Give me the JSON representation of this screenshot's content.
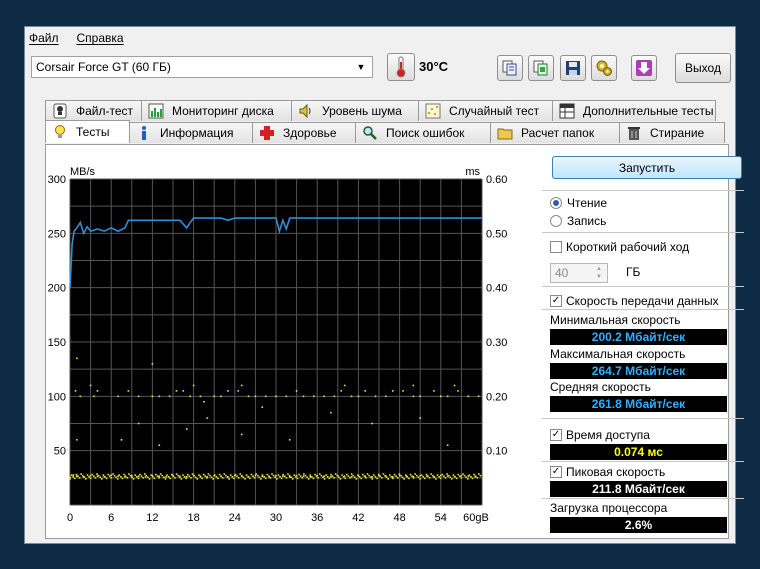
{
  "menu": [
    {
      "label": "Файл"
    },
    {
      "label": "Справка"
    }
  ],
  "toolbar": {
    "drive": "Corsair Force GT (60 ГБ)",
    "temperature": "30°C",
    "exit_label": "Выход"
  },
  "tabs_top": [
    {
      "label": "Файл-тест",
      "icon": "info-pin-icon"
    },
    {
      "label": "Мониторинг диска",
      "icon": "bar-chart-icon"
    },
    {
      "label": "Уровень шума",
      "icon": "speaker-icon"
    },
    {
      "label": "Случайный тест",
      "icon": "scatter-icon"
    },
    {
      "label": "Дополнительные тесты",
      "icon": "table-icon"
    }
  ],
  "tabs_bottom": [
    {
      "label": "Тесты",
      "icon": "lightbulb-icon",
      "active": true
    },
    {
      "label": "Информация",
      "icon": "info-icon"
    },
    {
      "label": "Здоровье",
      "icon": "red-cross-icon"
    },
    {
      "label": "Поиск ошибок",
      "icon": "magnifier-icon"
    },
    {
      "label": "Расчет папок",
      "icon": "folder-icon"
    },
    {
      "label": "Стирание",
      "icon": "trash-icon"
    }
  ],
  "chart_data": {
    "type": "line",
    "y_left_label": "MB/s",
    "y_right_label": "ms",
    "x_ticks": [
      "0",
      "6",
      "12",
      "18",
      "24",
      "30",
      "36",
      "42",
      "48",
      "54",
      "60gB"
    ],
    "y_left_ticks": [
      "300",
      "250",
      "200",
      "150",
      "100",
      "50"
    ],
    "y_right_ticks": [
      "0.60",
      "0.50",
      "0.40",
      "0.30",
      "0.20",
      "0.10"
    ],
    "ylim_left": [
      0,
      300
    ],
    "ylim_right": [
      0,
      0.6
    ],
    "xlim": [
      0,
      60
    ],
    "grid": true,
    "series": [
      {
        "type": "line",
        "color": "#2f8fd6",
        "points": [
          [
            0,
            200
          ],
          [
            0.3,
            240
          ],
          [
            0.6,
            252
          ],
          [
            1,
            255
          ],
          [
            1.5,
            260
          ],
          [
            2,
            250
          ],
          [
            2.5,
            256
          ],
          [
            3,
            252
          ],
          [
            4,
            254
          ],
          [
            5,
            252
          ],
          [
            6,
            255
          ],
          [
            7,
            252
          ],
          [
            8,
            255
          ],
          [
            8.5,
            262
          ],
          [
            9,
            262
          ],
          [
            12,
            262
          ],
          [
            15,
            262
          ],
          [
            16,
            262
          ],
          [
            17,
            255
          ],
          [
            17.5,
            260
          ],
          [
            18,
            264
          ],
          [
            20,
            264
          ],
          [
            22,
            264
          ],
          [
            23,
            262
          ],
          [
            24,
            264
          ],
          [
            28,
            264
          ],
          [
            30,
            264
          ],
          [
            30.5,
            252
          ],
          [
            31,
            262
          ],
          [
            31.5,
            254
          ],
          [
            32,
            264
          ],
          [
            34,
            264
          ],
          [
            38,
            264
          ],
          [
            41,
            264
          ],
          [
            44,
            264
          ],
          [
            48,
            264
          ],
          [
            52,
            264
          ],
          [
            56,
            264
          ],
          [
            60,
            264
          ]
        ]
      },
      {
        "type": "scatter",
        "color": "#e8e830",
        "points": [
          [
            0.5,
            0.055
          ],
          [
            1,
            0.053
          ],
          [
            2,
            0.052
          ],
          [
            3,
            0.054
          ],
          [
            4,
            0.053
          ],
          [
            5,
            0.052
          ],
          [
            6,
            0.055
          ],
          [
            7,
            0.053
          ],
          [
            8,
            0.052
          ],
          [
            9,
            0.054
          ],
          [
            10,
            0.053
          ],
          [
            11,
            0.052
          ],
          [
            12,
            0.054
          ],
          [
            13,
            0.053
          ],
          [
            14,
            0.052
          ],
          [
            15,
            0.054
          ],
          [
            16,
            0.053
          ],
          [
            17,
            0.052
          ],
          [
            18,
            0.054
          ],
          [
            19,
            0.053
          ],
          [
            20,
            0.052
          ],
          [
            21,
            0.054
          ],
          [
            22,
            0.053
          ],
          [
            23,
            0.052
          ],
          [
            24,
            0.054
          ],
          [
            25,
            0.053
          ],
          [
            26,
            0.052
          ],
          [
            27,
            0.054
          ],
          [
            28,
            0.053
          ],
          [
            29,
            0.052
          ],
          [
            30,
            0.054
          ],
          [
            31,
            0.053
          ],
          [
            32,
            0.052
          ],
          [
            33,
            0.054
          ],
          [
            34,
            0.053
          ],
          [
            35,
            0.052
          ],
          [
            36,
            0.054
          ],
          [
            37,
            0.053
          ],
          [
            38,
            0.052
          ],
          [
            39,
            0.054
          ],
          [
            40,
            0.053
          ],
          [
            41,
            0.052
          ],
          [
            42,
            0.054
          ],
          [
            43,
            0.053
          ],
          [
            44,
            0.052
          ],
          [
            45,
            0.054
          ],
          [
            46,
            0.053
          ],
          [
            47,
            0.052
          ],
          [
            48,
            0.054
          ],
          [
            49,
            0.053
          ],
          [
            50,
            0.052
          ],
          [
            51,
            0.054
          ],
          [
            52,
            0.053
          ],
          [
            53,
            0.052
          ],
          [
            54,
            0.054
          ],
          [
            55,
            0.053
          ],
          [
            56,
            0.052
          ],
          [
            57,
            0.054
          ],
          [
            58,
            0.053
          ],
          [
            59,
            0.052
          ],
          [
            0.8,
            0.21
          ],
          [
            1.5,
            0.2
          ],
          [
            3.5,
            0.2
          ],
          [
            4,
            0.21
          ],
          [
            7,
            0.2
          ],
          [
            8.5,
            0.21
          ],
          [
            10,
            0.2
          ],
          [
            12,
            0.2
          ],
          [
            13,
            0.2
          ],
          [
            14.5,
            0.2
          ],
          [
            15.5,
            0.21
          ],
          [
            16.5,
            0.21
          ],
          [
            17.5,
            0.2
          ],
          [
            19,
            0.2
          ],
          [
            19.5,
            0.19
          ],
          [
            21,
            0.2
          ],
          [
            22,
            0.2
          ],
          [
            23,
            0.21
          ],
          [
            24.5,
            0.21
          ],
          [
            26,
            0.2
          ],
          [
            27,
            0.2
          ],
          [
            28.5,
            0.2
          ],
          [
            30,
            0.2
          ],
          [
            31.5,
            0.2
          ],
          [
            33,
            0.21
          ],
          [
            34,
            0.2
          ],
          [
            35.5,
            0.2
          ],
          [
            37,
            0.2
          ],
          [
            38.5,
            0.2
          ],
          [
            39.5,
            0.21
          ],
          [
            41,
            0.2
          ],
          [
            42,
            0.2
          ],
          [
            43,
            0.21
          ],
          [
            44.5,
            0.2
          ],
          [
            46,
            0.2
          ],
          [
            47,
            0.21
          ],
          [
            48.5,
            0.21
          ],
          [
            50,
            0.2
          ],
          [
            51,
            0.2
          ],
          [
            53,
            0.21
          ],
          [
            54,
            0.2
          ],
          [
            55,
            0.2
          ],
          [
            56.5,
            0.21
          ],
          [
            58,
            0.2
          ],
          [
            59.5,
            0.2
          ],
          [
            1,
            0.27
          ],
          [
            12,
            0.26
          ],
          [
            1,
            0.12
          ],
          [
            7.5,
            0.12
          ],
          [
            10,
            0.15
          ],
          [
            13,
            0.11
          ],
          [
            17,
            0.14
          ],
          [
            20,
            0.16
          ],
          [
            25,
            0.13
          ],
          [
            28,
            0.18
          ],
          [
            32,
            0.12
          ],
          [
            38,
            0.17
          ],
          [
            44,
            0.15
          ],
          [
            51,
            0.16
          ],
          [
            55,
            0.11
          ],
          [
            3,
            0.22
          ],
          [
            18,
            0.22
          ],
          [
            25,
            0.22
          ],
          [
            40,
            0.22
          ],
          [
            50,
            0.22
          ],
          [
            56,
            0.22
          ]
        ]
      }
    ]
  },
  "controls": {
    "start_label": "Запустить",
    "read_label": "Чтение",
    "write_label": "Запись",
    "read_selected": true,
    "short_stroke_label": "Короткий рабочий ход",
    "short_stroke_checked": false,
    "short_stroke_value": "40",
    "short_stroke_unit": "ГБ",
    "transfer_rate_label": "Скорость передачи данных",
    "transfer_rate_checked": true,
    "min_label": "Минимальная скорость",
    "min_value": "200.2 Мбайт/сек",
    "max_label": "Максимальная скорость",
    "max_value": "264.7 Мбайт/сек",
    "avg_label": "Средняя скорость",
    "avg_value": "261.8 Мбайт/сек",
    "access_time_label": "Время доступа",
    "access_time_checked": true,
    "access_time_value": "0.074 мс",
    "burst_label": "Пиковая скорость",
    "burst_checked": true,
    "burst_value": "211.8 Мбайт/сек",
    "cpu_label": "Загрузка процессора",
    "cpu_value": "2.6%",
    "colors": {
      "speed": "#2fb0ff",
      "access": "#ffff00",
      "burst": "#ffffff",
      "cpu": "#ffffff"
    }
  }
}
